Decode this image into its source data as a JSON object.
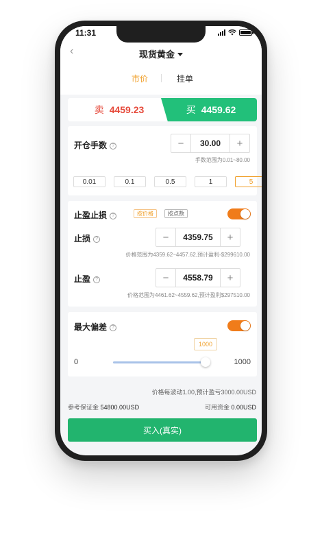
{
  "status_bar": {
    "time": "11:31"
  },
  "nav": {
    "title": "现货黄金",
    "back_glyph": "‹"
  },
  "tabs": {
    "market": "市价",
    "limit": "挂单"
  },
  "trade": {
    "sell_label": "卖",
    "sell_price": "4459.23",
    "buy_label": "买",
    "buy_price": "4459.62"
  },
  "open": {
    "label": "开仓手数",
    "value": "30.00",
    "hint": "手数范围为0.01~80.00",
    "lots": [
      "0.01",
      "0.1",
      "0.5",
      "1",
      "5"
    ],
    "selected_lot": "5"
  },
  "tp_sl": {
    "label": "止盈止损",
    "mode_price": "按价格",
    "mode_points": "按点数",
    "enabled": true,
    "stop_loss": {
      "label": "止损",
      "value": "4359.75",
      "hint": "价格范围为4359.62~4457.62,预计盈利-$299610.00"
    },
    "take_profit": {
      "label": "止盈",
      "value": "4558.79",
      "hint": "价格范围为4461.62~4559.62,预计盈利$297510.00"
    }
  },
  "deviation": {
    "label": "最大偏差",
    "enabled": true,
    "min": "0",
    "max": "1000",
    "value": "1000"
  },
  "summary": {
    "per_tick": "价格每波动1.00,预计盈亏3000.00USD",
    "margin_label": "参考保证金",
    "margin_value": "54800.00USD",
    "funds_label": "可用资金",
    "funds_value": "0.00USD"
  },
  "submit_label": "买入(真实)",
  "colors": {
    "accent": "#f0a02b",
    "buy": "#22c07a",
    "sell": "#e64a3b",
    "toggle_on": "#f07c1a"
  },
  "icons": {
    "help": "question-circle-icon",
    "back": "chevron-left-icon",
    "dropdown": "caret-down-icon"
  }
}
